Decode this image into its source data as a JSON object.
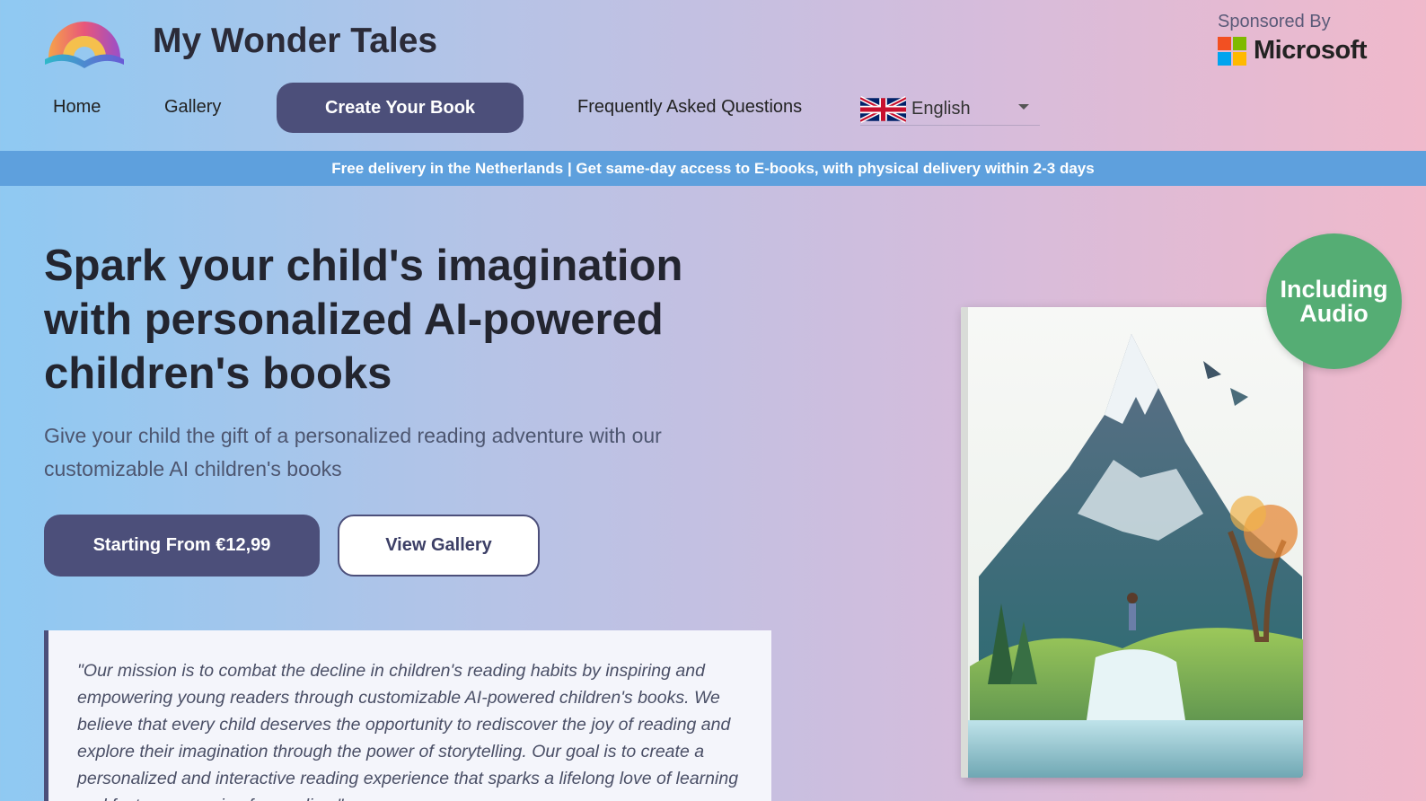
{
  "header": {
    "brand": "My Wonder Tales",
    "sponsor_label": "Sponsored By",
    "sponsor_name": "Microsoft",
    "logo_icon": "rainbow-book-icon"
  },
  "nav": {
    "home": "Home",
    "gallery": "Gallery",
    "create": "Create Your Book",
    "faq": "Frequently Asked Questions",
    "language": "English",
    "language_flag": "uk-flag-icon"
  },
  "banner": {
    "text": "Free delivery in the Netherlands | Get same-day access to E-books, with physical delivery within 2-3 days"
  },
  "hero": {
    "title": "Spark your child's imagination with personalized AI-powered children's books",
    "subtitle": "Give your child the gift of a personalized reading adventure with our customizable AI children's books",
    "primary_button": "Starting From €12,99",
    "secondary_button": "View Gallery",
    "quote": "\"Our mission is to combat the decline in children's reading habits by inspiring and empowering young readers through customizable AI-powered children's books. We believe that every child deserves the opportunity to rediscover the joy of reading and explore their imagination through the power of storytelling. Our goal is to create a personalized and interactive reading experience that sparks a lifelong love of learning and fosters a passion for reading.\""
  },
  "badge": {
    "line1": "Including",
    "line2": "Audio"
  },
  "colors": {
    "primary": "#4c4f7a",
    "banner": "#5ea0dd",
    "badge": "#55ad74"
  }
}
